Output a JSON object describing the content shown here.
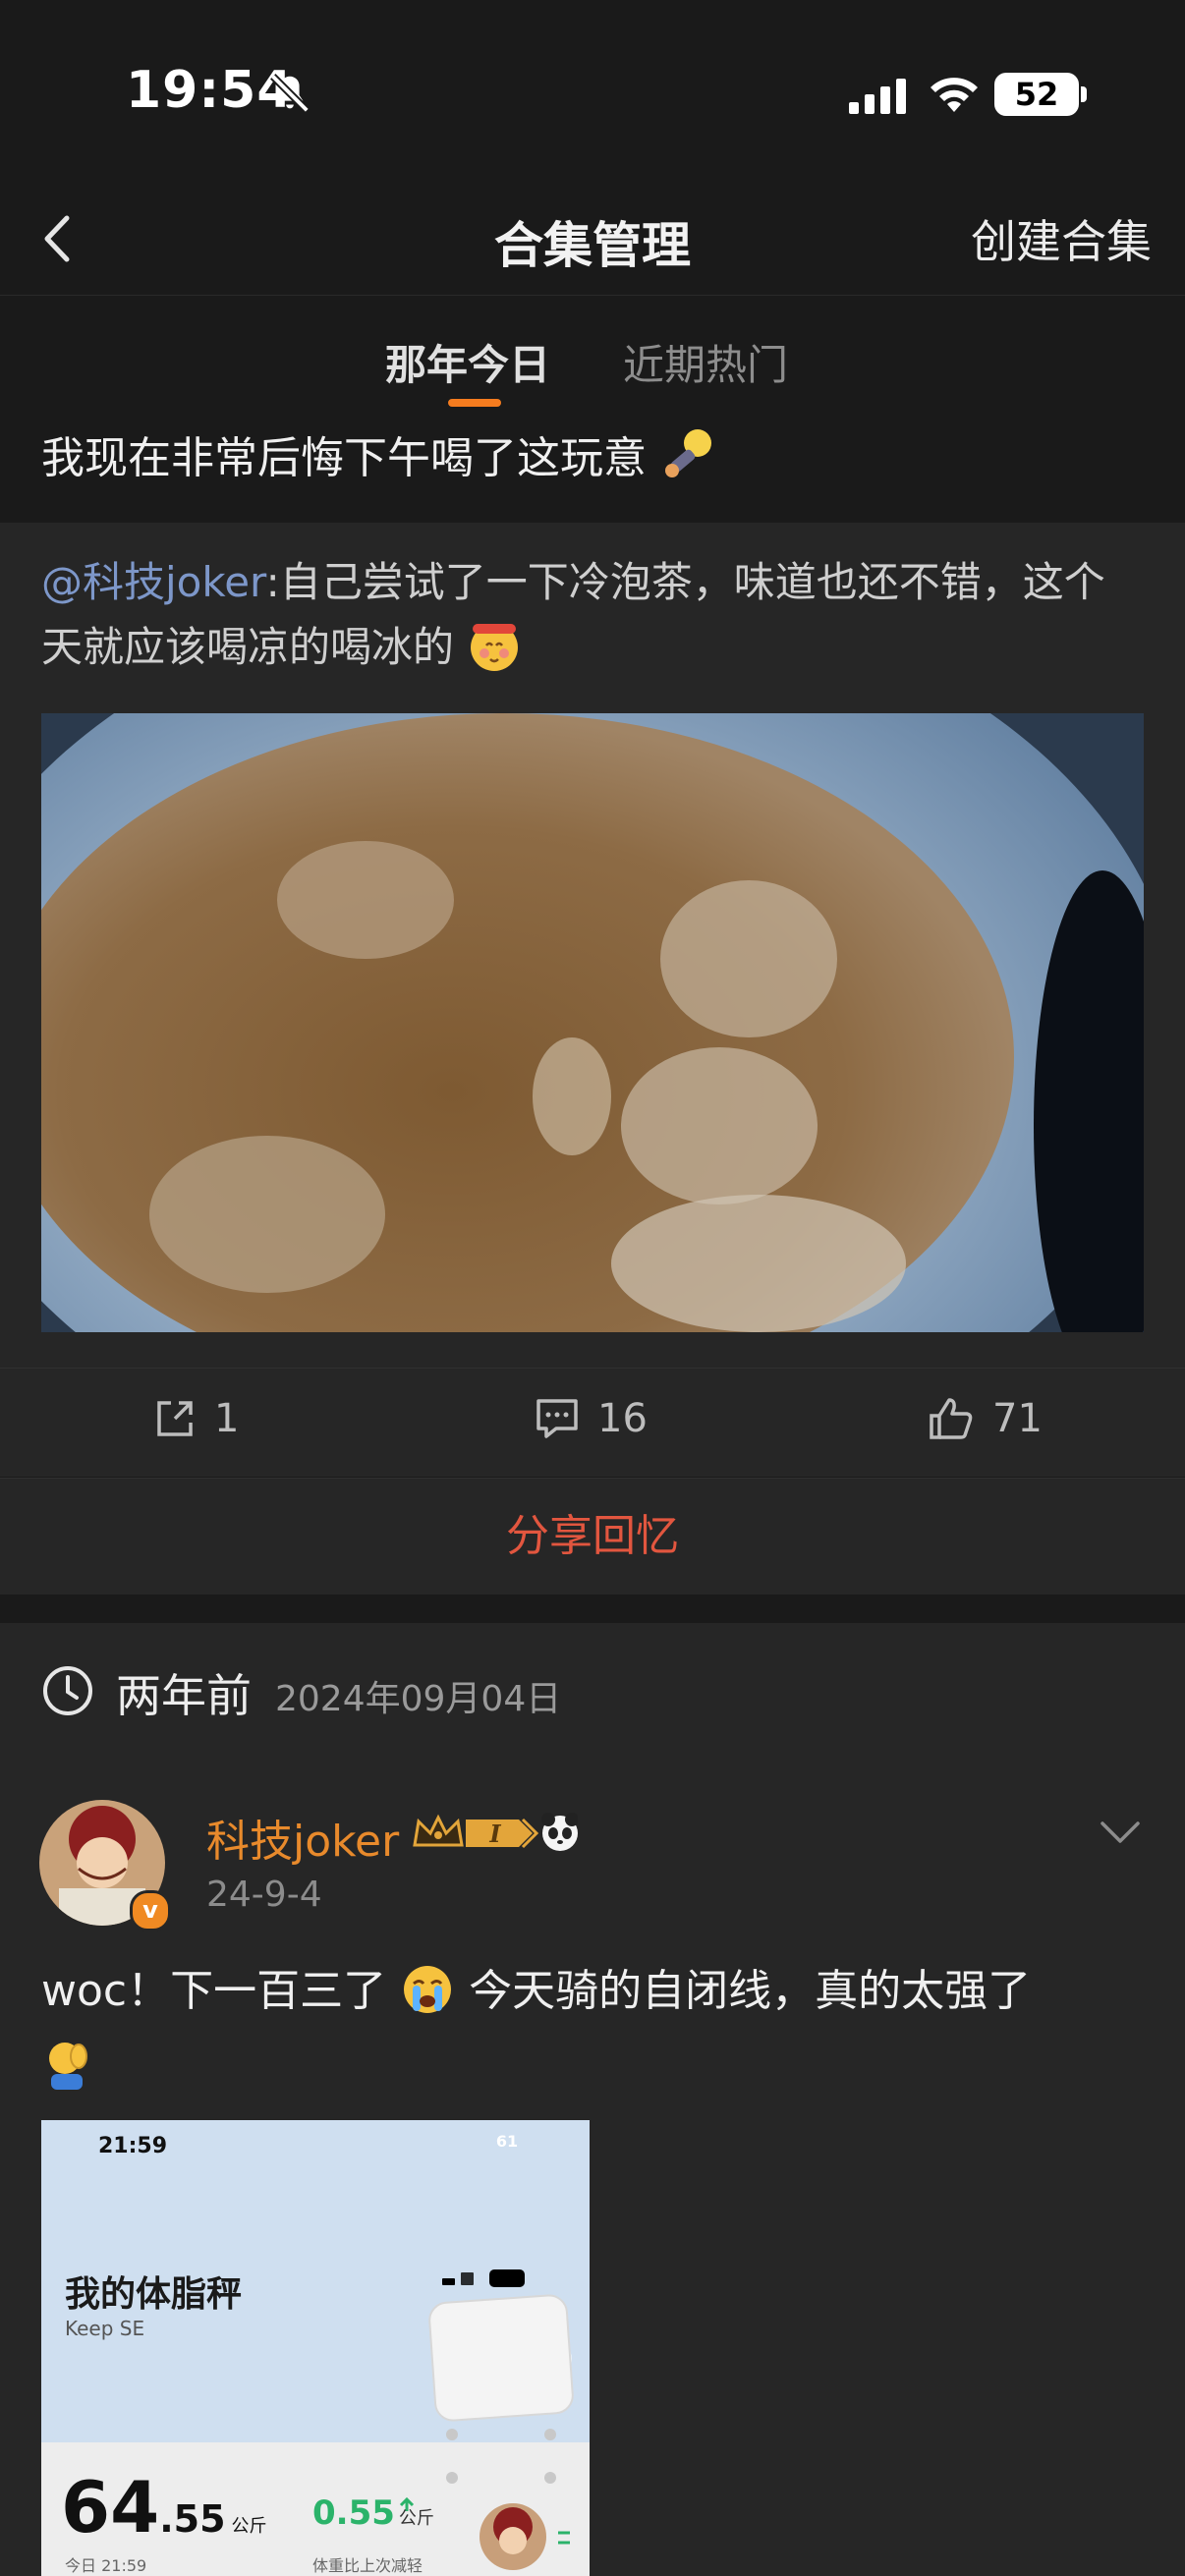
{
  "status_bar": {
    "time": "19:54",
    "battery": "52"
  },
  "nav": {
    "title": "合集管理",
    "create_label": "创建合集"
  },
  "tabs": [
    {
      "label": "那年今日",
      "active": true
    },
    {
      "label": "近期热门",
      "active": false
    }
  ],
  "headline": "我现在非常后悔下午喝了这玩意",
  "repost": {
    "mention": "@科技joker",
    "text": ":自己尝试了一下冷泡茶，味道也还不错，这个天就应该喝凉的喝冰的"
  },
  "actions": {
    "share_count": "1",
    "comment_count": "16",
    "like_count": "71"
  },
  "share_memory_label": "分享回忆",
  "memory": {
    "years_ago": "两年前",
    "date": "2024年09月04日"
  },
  "post": {
    "author": "科技joker",
    "badge_level": "I",
    "date": "24-9-4",
    "text_part1": "woc！下一百三了",
    "text_part2": "今天骑的自闭线，真的太强了",
    "image": {
      "time": "21:59",
      "battery": "61",
      "title": "我的体脂秤",
      "subtitle": "Keep SE",
      "weight_int": "64",
      "weight_dec": ".55",
      "weight_unit": "公斤",
      "weight_caption": "今日 21:59",
      "diff": "0.55",
      "diff_unit": "公斤",
      "diff_caption": "体重比上次减轻"
    }
  },
  "colors": {
    "accent": "#f57c1f",
    "link": "#7d97c9",
    "share": "#e2563f",
    "author": "#e88a2c"
  }
}
